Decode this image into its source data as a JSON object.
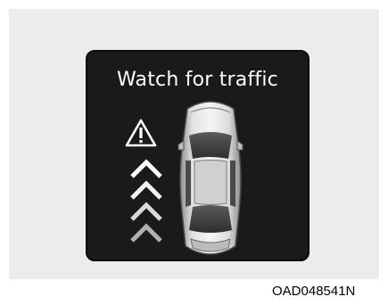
{
  "display": {
    "message": "Watch for traffic"
  },
  "icons": {
    "warning": "warning-triangle-icon",
    "chevrons": "chevron-up-icon",
    "vehicle": "car-top-view-icon"
  },
  "figure": {
    "code": "OAD048541N"
  },
  "colors": {
    "screen": "#1a1a1a",
    "text": "#ffffff",
    "chevron": "#ffffff",
    "car_body": "#d6d6d6",
    "background": "#ececec"
  }
}
